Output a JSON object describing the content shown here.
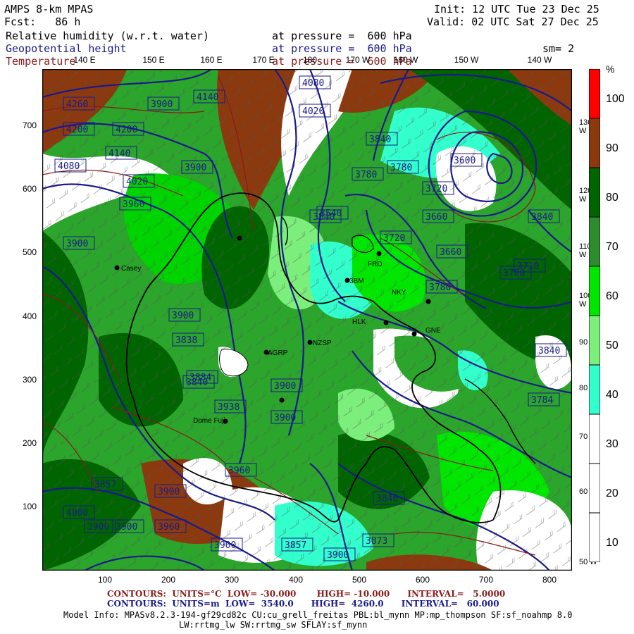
{
  "header": {
    "model": "AMPS 8-km MPAS",
    "fcst": "Fcst:   86 h",
    "init": "Init: 12 UTC Tue 23 Dec 25",
    "valid": "Valid: 02 UTC Sat 27 Dec 25",
    "fields": [
      {
        "name": "Relative humidity (w.r.t. water)",
        "level": "at pressure =  600 hPa",
        "color": "#000000"
      },
      {
        "name": "Geopotential height",
        "level": "at pressure =  600 hPa",
        "color": "#1a1a8c"
      },
      {
        "name": "Temperature",
        "level": "at pressure =  600 hPa",
        "color": "#8b1a1a"
      }
    ],
    "smoothing": "sm= 2"
  },
  "axes": {
    "y_ticks": [
      "700",
      "600",
      "500",
      "400",
      "300",
      "200",
      "100"
    ],
    "x_ticks": [
      "100",
      "200",
      "300",
      "400",
      "500",
      "600",
      "700",
      "800"
    ],
    "lon_top": [
      "140 E",
      "150 E",
      "160 E",
      "170 E",
      "180",
      "170 W",
      "160 W",
      "150 W",
      "140 W"
    ],
    "lon_right": [
      "130 W",
      "120 W",
      "110 W",
      "100 W",
      "90 W",
      "80 W",
      "70 W",
      "60 W",
      "50 W"
    ]
  },
  "colorbar": {
    "unit": "%",
    "labels": [
      "100",
      "90",
      "80",
      "70",
      "60",
      "50",
      "40",
      "30",
      "20",
      "10"
    ],
    "colors": [
      "#ff0000",
      "#8b3a0f",
      "#006400",
      "#2e8b2e",
      "#00e600",
      "#7cee7c",
      "#33ffcc",
      "#ffffff",
      "#ffffff",
      "#ffffff"
    ]
  },
  "height_labels": [
    "4260",
    "4200",
    "4200",
    "4140",
    "4080",
    "4020",
    "3960",
    "3900",
    "3900",
    "3900",
    "3840",
    "3840",
    "3780",
    "3780",
    "3720",
    "3720",
    "3660",
    "3660",
    "3600",
    "3540",
    "3900",
    "3960",
    "4020",
    "4080",
    "4140",
    "4080",
    "3840",
    "3900",
    "3900",
    "3900",
    "3720",
    "3784",
    "3857",
    "3840",
    "3873",
    "3857",
    "3900",
    "3960",
    "3900",
    "3900",
    "3900",
    "3838",
    "3840",
    "3884",
    "3840",
    "3938",
    "3780",
    "3780"
  ],
  "places": [
    {
      "name": "3BM"
    },
    {
      "name": "FRD"
    },
    {
      "name": "NZSP"
    },
    {
      "name": "AGRP"
    },
    {
      "name": "HLK"
    },
    {
      "name": "NKY"
    },
    {
      "name": "GNE"
    },
    {
      "name": "Dome Fuji"
    },
    {
      "name": "Casey"
    }
  ],
  "footer": {
    "line1_label": "CONTOURS:  UNITS=°C  LOW= -30.000       HIGH= -10.000      INTERVAL=   5.0000",
    "line2_label": "CONTOURS:  UNITS=m  LOW=  3540.0      HIGH=  4260.0      INTERVAL=   60.000",
    "line1_color": "#8b1a1a",
    "line2_color": "#1a1a8c",
    "info1": "Model Info: MPASv8.2.3-194-gf29cd82c CU:cu_grell_freitas PBL:bl_mynn MP:mp_thompson SF:sf_noahmp 8.0",
    "info2": "LW:rrtmg_lw SW:rrtmg_sw SFLAY:sf_mynn"
  }
}
